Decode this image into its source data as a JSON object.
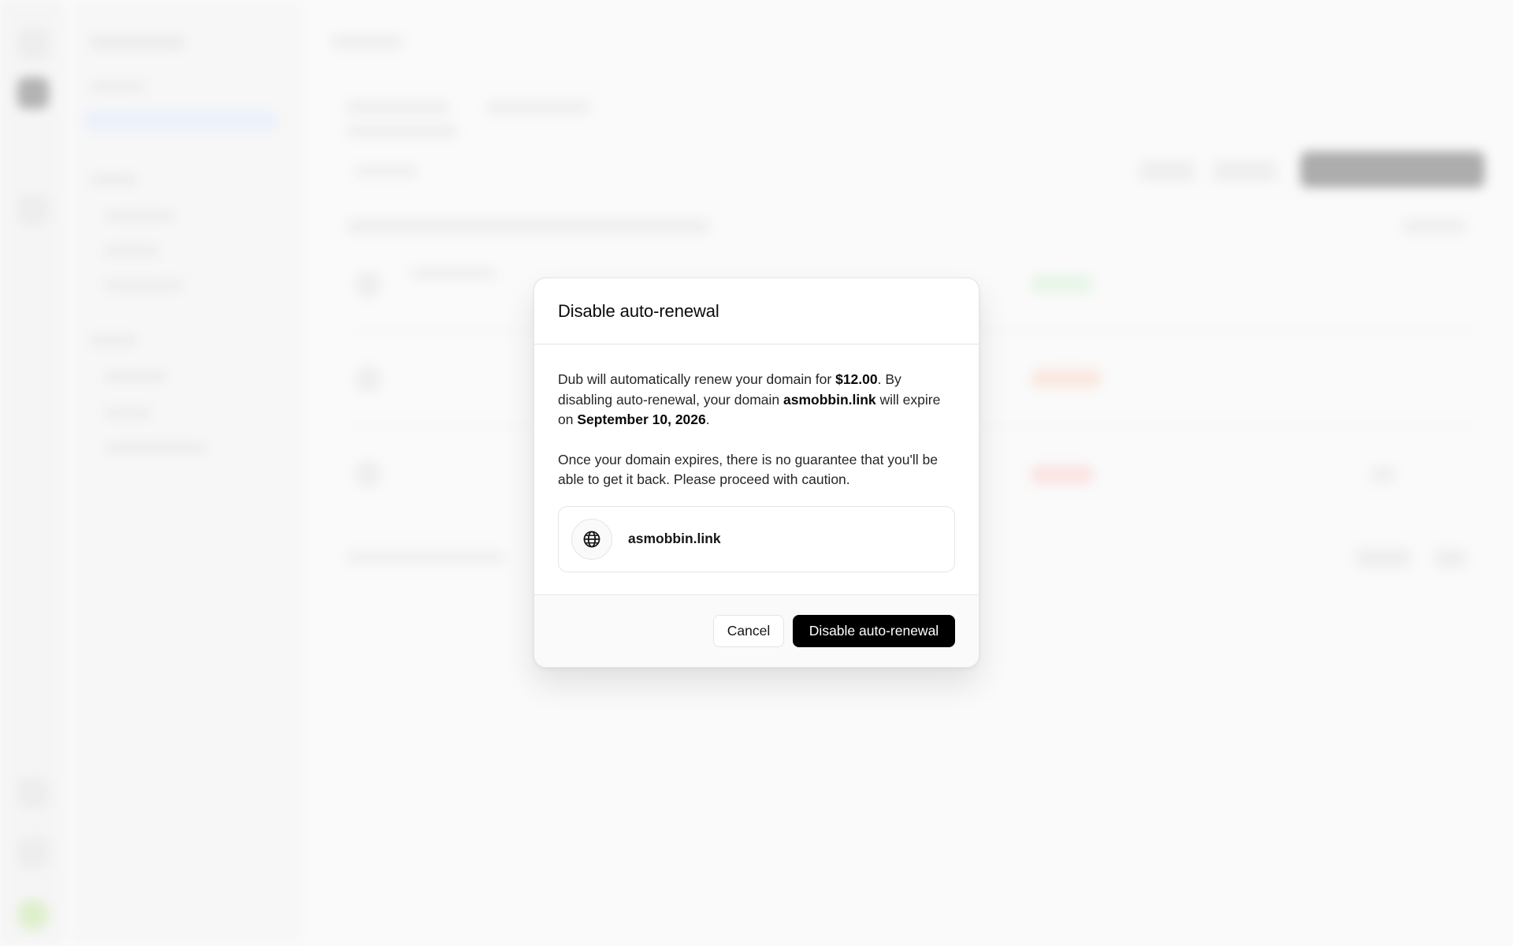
{
  "modal": {
    "title": "Disable auto-renewal",
    "body": {
      "p1_prefix": "Dub will automatically renew your domain for ",
      "price": "$12.00",
      "p1_mid": ". By disabling auto-renewal, your domain ",
      "domain": "asmobbin.link",
      "p1_mid2": " will expire on ",
      "expiry_date": "September 10, 2026",
      "p1_suffix": ".",
      "p2": "Once your domain expires, there is no guarantee that you'll be able to get it back. Please proceed with caution."
    },
    "domain_card": {
      "icon": "globe-icon",
      "name": "asmobbin.link"
    },
    "footer": {
      "cancel_label": "Cancel",
      "confirm_label": "Disable auto-renewal"
    }
  },
  "colors": {
    "primary_button": "#000000",
    "status_active": "#d9f1d9",
    "status_warning": "#fbd9c9",
    "status_error": "#fbd0d0"
  }
}
